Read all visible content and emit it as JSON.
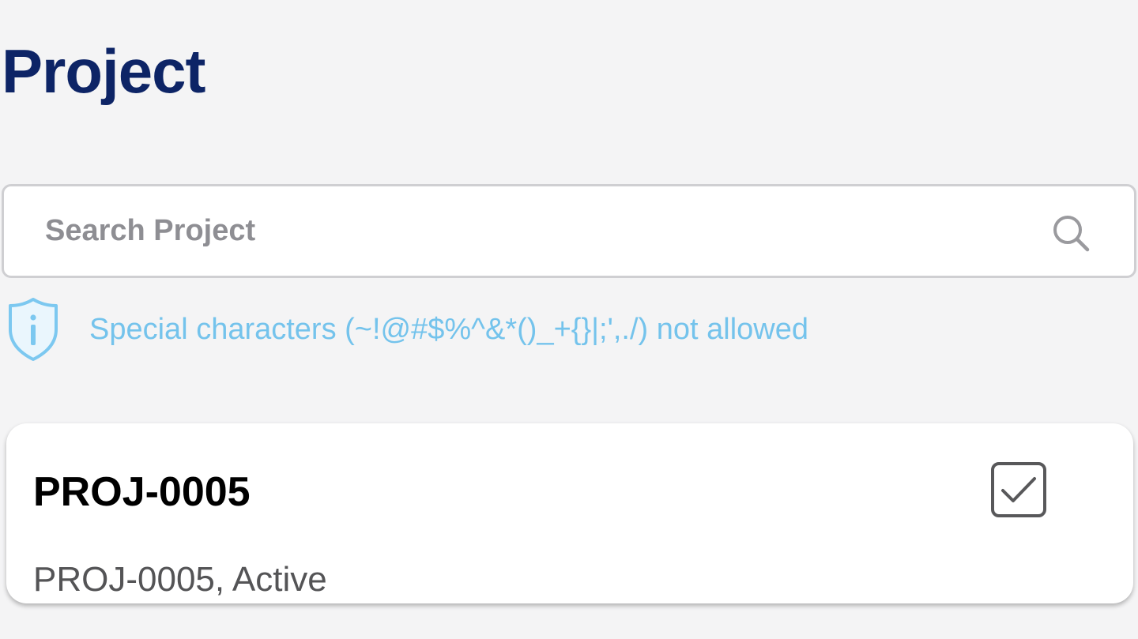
{
  "header": {
    "title": "Project"
  },
  "search": {
    "placeholder": "Search Project",
    "value": "",
    "icon": "search-icon"
  },
  "info": {
    "icon": "shield-info-icon",
    "message": "Special characters (~!@#$%^&*()_+{}|;',./) not allowed",
    "color": "#74c3ec"
  },
  "projects": [
    {
      "code": "PROJ-0005",
      "subtitle": "PROJ-0005, Active",
      "checked": true
    }
  ],
  "colors": {
    "title": "#0d2466",
    "background": "#f4f4f5",
    "card": "#ffffff",
    "info_text": "#74c3ec"
  }
}
